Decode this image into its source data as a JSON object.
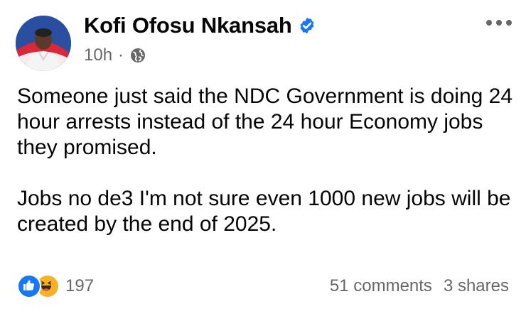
{
  "author": {
    "name": "Kofi Ofosu Nkansah",
    "verified": true,
    "avatar_icon": "profile-photo"
  },
  "meta": {
    "time": "10h",
    "separator": "·",
    "audience_icon": "globe-icon"
  },
  "post": {
    "paragraphs": [
      "Someone just said the NDC Government is doing 24 hour arrests instead of the 24 hour Economy jobs they promised.",
      "Jobs no de3 I'm not sure even 1000 new jobs will be created by the end of 2025."
    ]
  },
  "reactions": {
    "icons": [
      "like-icon",
      "haha-icon"
    ],
    "count": "197"
  },
  "engagement": {
    "comments": "51 comments",
    "shares": "3 shares"
  },
  "colors": {
    "accent": "#1877f2",
    "secondary_text": "#65676b",
    "haha": "#f7b125"
  }
}
